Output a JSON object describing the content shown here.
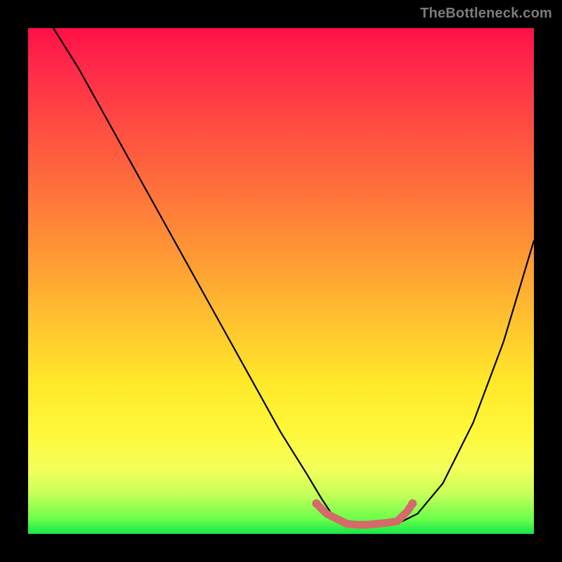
{
  "watermark": "TheBottleneck.com",
  "colors": {
    "frame": "#000000",
    "gradient_top": "#ff1047",
    "gradient_mid1": "#ff7a3a",
    "gradient_mid2": "#ffe82a",
    "gradient_bottom": "#14e74a",
    "curve": "#000000",
    "marker": "#d46a6a"
  },
  "chart_data": {
    "type": "line",
    "title": "",
    "xlabel": "",
    "ylabel": "",
    "xlim": [
      0,
      100
    ],
    "ylim": [
      0,
      100
    ],
    "grid": false,
    "legend": false,
    "series": [
      {
        "name": "bottleneck-curve",
        "x": [
          5,
          10,
          15,
          20,
          25,
          30,
          35,
          40,
          45,
          50,
          55,
          58,
          60,
          63,
          66,
          70,
          73,
          77,
          82,
          88,
          94,
          100
        ],
        "y": [
          100,
          92,
          83,
          74,
          65,
          56,
          47,
          38,
          29,
          20,
          12,
          7,
          4,
          2,
          1.5,
          1.5,
          2,
          4,
          10,
          22,
          38,
          58
        ]
      }
    ],
    "markers": {
      "name": "highlight-segment",
      "color": "#d46a6a",
      "x": [
        57,
        59,
        61,
        63,
        65,
        67,
        69,
        71,
        73,
        75,
        76
      ],
      "y": [
        6,
        4,
        3,
        2,
        1.8,
        1.8,
        2,
        2.2,
        2.5,
        4.5,
        6
      ]
    }
  }
}
